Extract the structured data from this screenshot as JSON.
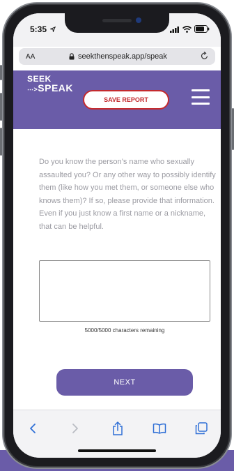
{
  "status": {
    "time": "5:35",
    "location_icon": "location-arrow-icon",
    "icons": [
      "signal-icon",
      "wifi-icon",
      "battery-icon"
    ]
  },
  "browser": {
    "text_size_label": "AA",
    "url": "seekthenspeak.app/speak",
    "secure_icon": "lock-icon",
    "reload_icon": "reload-icon"
  },
  "header": {
    "logo_line1": "SEEK",
    "logo_line2": "SPEAK",
    "save_report_label": "SAVE REPORT",
    "menu_icon": "hamburger-menu-icon",
    "brand_color": "#6a5ca8",
    "save_color": "#c42a2e"
  },
  "form": {
    "question": "Do you know the person’s name who sexually assaulted you? Or any other way to possibly identify them (like how you met them, or someone else who knows them)? If so, please provide that information. Even if you just know a first name or a nickname, that can be helpful.",
    "response_value": "",
    "char_counter": "5000/5000 characters remaining",
    "next_label": "NEXT"
  },
  "toolbar": {
    "items": [
      "back-icon",
      "forward-icon",
      "share-icon",
      "bookmarks-icon",
      "tabs-icon"
    ]
  }
}
